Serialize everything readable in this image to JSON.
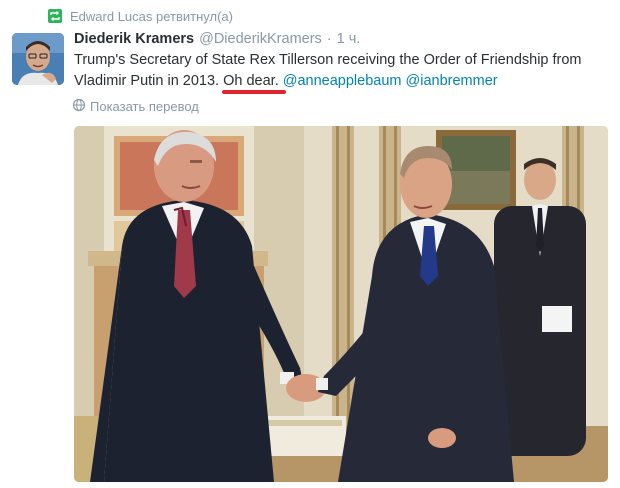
{
  "retweet": {
    "icon": "retweet-icon",
    "text": "Edward Lucas ретвитнул(а)",
    "color": "#2fb45a"
  },
  "author": {
    "name": "Diederik Kramers",
    "handle": "@DiederikKramers",
    "separator": "·",
    "time": "1 ч."
  },
  "tweet": {
    "text_part1": "Trump's Secretary of State Rex Tillerson receiving the Order of Friendship from Vladimir Putin in 2013. ",
    "text_highlight": "Oh dear.",
    "mention1": "@anneapplebaum",
    "mention2": "@ianbremmer"
  },
  "translate": {
    "icon": "globe-icon",
    "label": "Показать перевод"
  },
  "colors": {
    "link": "#0084b4",
    "meta": "#8899a6",
    "text": "#292f33",
    "underline": "#e0242e"
  }
}
